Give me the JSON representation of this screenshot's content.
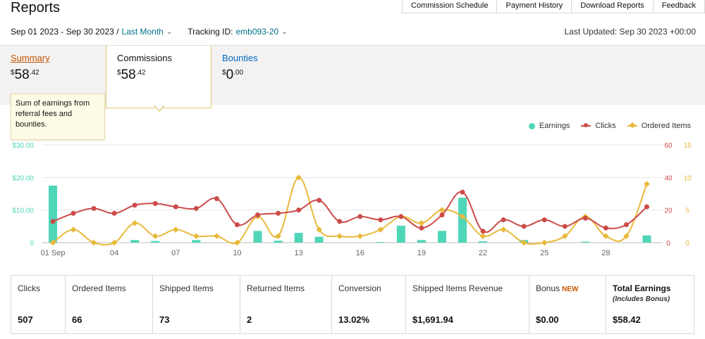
{
  "page_title": "Reports",
  "top_tabs": [
    "Commission Schedule",
    "Payment History",
    "Download Reports",
    "Feedback"
  ],
  "filters": {
    "date_range": "Sep 01 2023 - Sep 30 2023 /",
    "period": "Last Month",
    "tracking_label": "Tracking ID:",
    "tracking_id": "emb093-20"
  },
  "last_updated": "Last Updated: Sep 30 2023 +00:00",
  "summary_tabs": [
    {
      "label": "Summary",
      "currency": "$",
      "whole": "58",
      "cents": ".42"
    },
    {
      "label": "Commissions",
      "currency": "$",
      "whole": "58",
      "cents": ".42"
    },
    {
      "label": "Bounties",
      "currency": "$",
      "whole": "0",
      "cents": ".00"
    }
  ],
  "tooltip": "Sum of earnings from referral fees and bounties.",
  "colors": {
    "earnings": "#4fd6b8",
    "clicks": "#cd4a4a",
    "ordered": "#e8b93a"
  },
  "chart_data": {
    "type": "bar+line",
    "legend": [
      "Earnings",
      "Clicks",
      "Ordered Items"
    ],
    "legend_position": "top-right",
    "x_tick_labels": [
      "01 Sep",
      "04",
      "07",
      "10",
      "13",
      "16",
      "19",
      "22",
      "25",
      "28"
    ],
    "x_tick_days": [
      1,
      4,
      7,
      10,
      13,
      16,
      19,
      22,
      25,
      28
    ],
    "days": [
      1,
      2,
      3,
      4,
      5,
      6,
      7,
      8,
      9,
      10,
      11,
      12,
      13,
      14,
      15,
      16,
      17,
      18,
      19,
      20,
      21,
      22,
      23,
      24,
      25,
      26,
      27,
      28,
      29,
      30
    ],
    "left_axis": {
      "ticks": [
        "0",
        "$10.00",
        "$20.00",
        "$30.00"
      ],
      "range": [
        0,
        30
      ]
    },
    "right_axis_clicks": {
      "ticks": [
        "0",
        "20",
        "40",
        "60"
      ],
      "range": [
        0,
        60
      ]
    },
    "right_axis_items": {
      "ticks": [
        "0",
        "5",
        "10",
        "15"
      ],
      "range": [
        0,
        15
      ]
    },
    "series": [
      {
        "name": "Earnings",
        "type": "bar",
        "values": [
          17.5,
          0,
          0,
          0,
          0.8,
          0.5,
          0,
          0.8,
          0,
          0,
          3.6,
          0.6,
          3.0,
          1.8,
          0,
          0,
          0.2,
          5.2,
          0.8,
          3.6,
          13.8,
          0.4,
          0,
          0.8,
          0,
          0,
          0.3,
          0,
          0,
          2.2
        ]
      },
      {
        "name": "Clicks",
        "type": "line",
        "values": [
          13,
          18,
          21,
          18,
          23,
          24,
          22,
          21,
          27,
          11,
          17,
          18,
          20,
          26,
          13,
          16,
          14,
          16,
          9,
          17,
          31,
          7,
          14,
          10,
          14,
          10,
          15,
          9,
          11,
          22
        ]
      },
      {
        "name": "Ordered Items",
        "type": "line",
        "values": [
          0,
          2,
          0,
          0,
          3,
          1,
          2,
          1,
          1,
          0,
          4,
          1,
          10,
          2,
          1,
          1,
          2,
          4,
          3,
          5,
          4,
          1,
          2,
          0,
          0,
          1,
          4,
          1,
          1,
          9
        ]
      }
    ]
  },
  "stats": [
    {
      "label": "Clicks",
      "value": "507"
    },
    {
      "label": "Ordered Items",
      "value": "66"
    },
    {
      "label": "Shipped Items",
      "value": "73"
    },
    {
      "label": "Returned Items",
      "value": "2"
    },
    {
      "label": "Conversion",
      "value": "13.02%"
    },
    {
      "label": "Shipped Items Revenue",
      "value": "$1,691.94"
    },
    {
      "label": "Bonus",
      "badge": "NEW",
      "value": "$0.00"
    },
    {
      "label": "Total Earnings",
      "sub": "(Includes Bonus)",
      "value": "$58.42"
    }
  ]
}
